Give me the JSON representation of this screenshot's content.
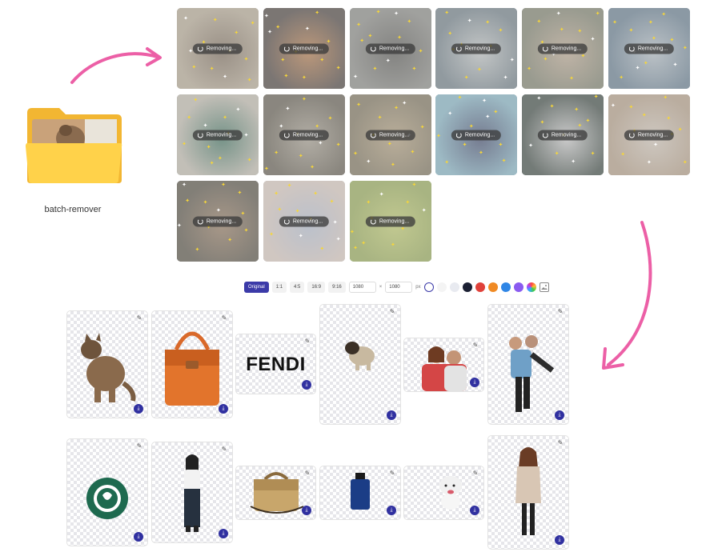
{
  "folder": {
    "name": "batch-remover"
  },
  "processing": {
    "status_label": "Removing..."
  },
  "toolbar": {
    "ratios": [
      "Original",
      "1:1",
      "4:5",
      "16:9",
      "9:16"
    ],
    "width_value": "1080",
    "height_value": "1080",
    "times_sign": "×",
    "unit": "px",
    "swatches": [
      "#ffffff",
      "#f0f0f0",
      "#e8eaf0",
      "#1b2033",
      "#e0413a",
      "#f08a24",
      "#2f86e6",
      "#8a5bf0"
    ]
  },
  "colors": {
    "accent": "#3b3aa8",
    "arrow": "#ec5fa6"
  },
  "result_text": {
    "fendi": "FENDI"
  }
}
